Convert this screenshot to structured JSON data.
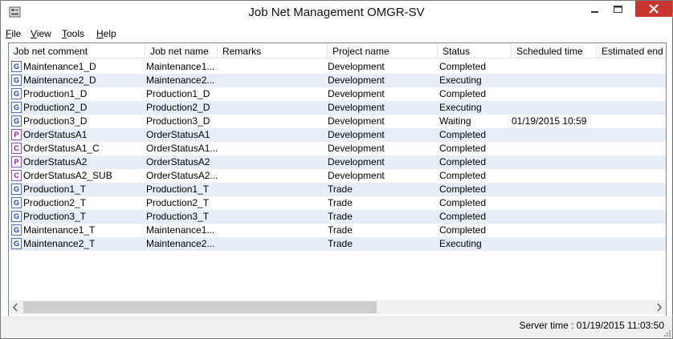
{
  "window": {
    "title": "Job Net Management OMGR-SV"
  },
  "menu": [
    {
      "label": "File",
      "mnemonic": "F",
      "rest": "ile"
    },
    {
      "label": "View",
      "mnemonic": "V",
      "rest": "iew"
    },
    {
      "label": "Tools",
      "mnemonic": "T",
      "rest": "ools"
    },
    {
      "label": "Help",
      "mnemonic": "H",
      "rest": "elp"
    }
  ],
  "columns": [
    "Job net comment",
    "Job net name",
    "Remarks",
    "Project name",
    "Status",
    "Scheduled time",
    "Estimated end t"
  ],
  "rows": [
    {
      "icon": "G",
      "comment": "Maintenance1_D",
      "name": "Maintenance1...",
      "remarks": "",
      "project": "Development",
      "status": "Completed",
      "scheduled": ""
    },
    {
      "icon": "G",
      "comment": "Maintenance2_D",
      "name": "Maintenance2...",
      "remarks": "",
      "project": "Development",
      "status": "Executing",
      "scheduled": ""
    },
    {
      "icon": "G",
      "comment": "Production1_D",
      "name": "Production1_D",
      "remarks": "",
      "project": "Development",
      "status": "Completed",
      "scheduled": ""
    },
    {
      "icon": "G",
      "comment": "Production2_D",
      "name": "Production2_D",
      "remarks": "",
      "project": "Development",
      "status": "Executing",
      "scheduled": ""
    },
    {
      "icon": "G",
      "comment": "Production3_D",
      "name": "Production3_D",
      "remarks": "",
      "project": "Development",
      "status": "Waiting",
      "scheduled": "01/19/2015 10:59"
    },
    {
      "icon": "P",
      "comment": "OrderStatusA1",
      "name": "OrderStatusA1",
      "remarks": "",
      "project": "Development",
      "status": "Completed",
      "scheduled": ""
    },
    {
      "icon": "C",
      "comment": "OrderStatusA1_C",
      "name": "OrderStatusA1...",
      "remarks": "",
      "project": "Development",
      "status": "Completed",
      "scheduled": ""
    },
    {
      "icon": "P",
      "comment": "OrderStatusA2",
      "name": "OrderStatusA2",
      "remarks": "",
      "project": "Development",
      "status": "Completed",
      "scheduled": ""
    },
    {
      "icon": "C",
      "comment": "OrderStatusA2_SUB",
      "name": "OrderStatusA2...",
      "remarks": "",
      "project": "Development",
      "status": "Completed",
      "scheduled": ""
    },
    {
      "icon": "G",
      "comment": "Production1_T",
      "name": "Production1_T",
      "remarks": "",
      "project": "Trade",
      "status": "Completed",
      "scheduled": ""
    },
    {
      "icon": "G",
      "comment": "Production2_T",
      "name": "Production2_T",
      "remarks": "",
      "project": "Trade",
      "status": "Completed",
      "scheduled": ""
    },
    {
      "icon": "G",
      "comment": "Production3_T",
      "name": "Production3_T",
      "remarks": "",
      "project": "Trade",
      "status": "Completed",
      "scheduled": ""
    },
    {
      "icon": "G",
      "comment": "Maintenance1_T",
      "name": "Maintenance1...",
      "remarks": "",
      "project": "Trade",
      "status": "Completed",
      "scheduled": ""
    },
    {
      "icon": "G",
      "comment": "Maintenance2_T",
      "name": "Maintenance2...",
      "remarks": "",
      "project": "Trade",
      "status": "Executing",
      "scheduled": ""
    }
  ],
  "statusbar": {
    "server_time": "Server time : 01/19/2015 11:03:50"
  },
  "colors": {
    "close_button": "#c7372f",
    "alt_row": "#e8eef7",
    "scroll_thumb": "#cdcdcd"
  }
}
